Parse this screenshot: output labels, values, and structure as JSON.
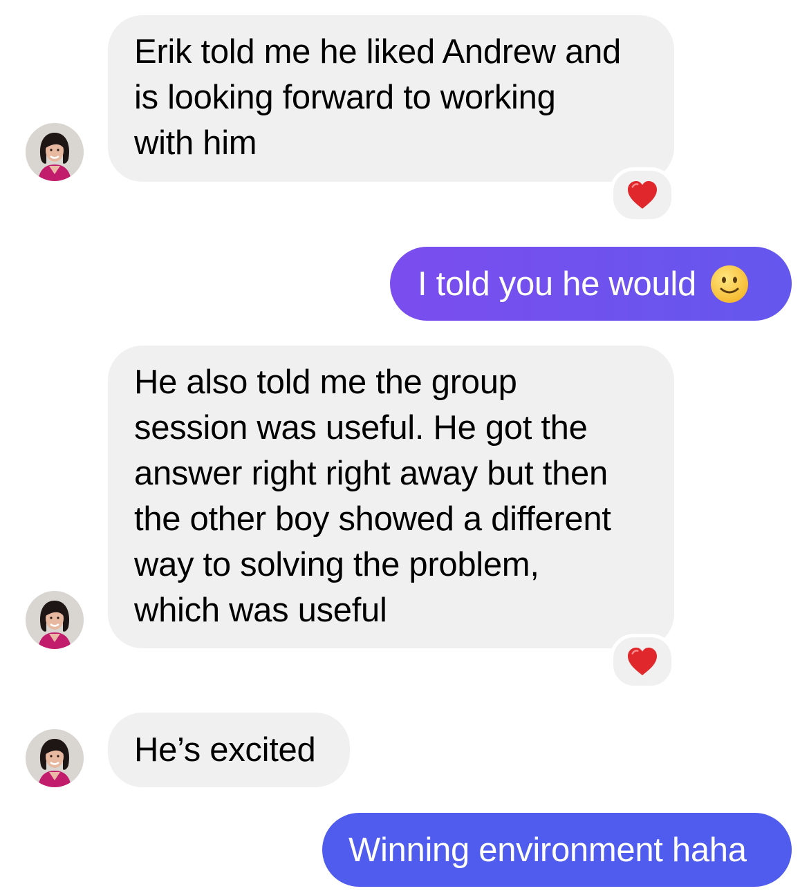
{
  "conversation": {
    "colors": {
      "incoming_bubble": "#f0f0f0",
      "outgoing_gradient_start": "#7b4dee",
      "outgoing_gradient_end": "#5a5cee",
      "outgoing_bubble_2": "#4f5cee",
      "reaction_heart": "#e0272b"
    },
    "messages": [
      {
        "direction": "incoming",
        "lines": [
          "Erik told me he liked Andrew and",
          "is looking forward to working",
          "with him"
        ],
        "reaction": "heart-icon"
      },
      {
        "direction": "outgoing",
        "text": "I told you he would",
        "emoji": "slightly-smiling-face-icon"
      },
      {
        "direction": "incoming",
        "lines": [
          "He also told me the group",
          "session was useful. He got the",
          "answer right right away but then",
          "the other boy showed a different",
          "way to solving the problem,",
          "which was useful"
        ],
        "reaction": "heart-icon"
      },
      {
        "direction": "incoming",
        "text": "He’s excited"
      },
      {
        "direction": "outgoing",
        "text": "Winning environment haha"
      }
    ]
  }
}
